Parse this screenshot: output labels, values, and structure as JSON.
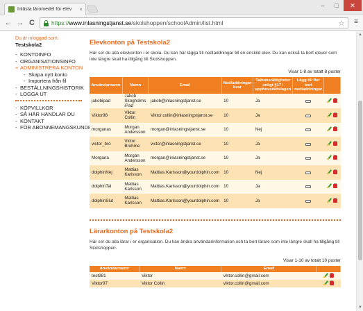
{
  "browser": {
    "tab_title": "Inlästa läromedel för elev",
    "tab_close": "×",
    "url_scheme": "https://",
    "url_host": "www.inlasningstjanst.se",
    "url_path": "/skolshoppen/schoolAdmin/list.html",
    "back_icon": "←",
    "forward_icon": "→",
    "reload_icon": "C",
    "star_icon": "☆",
    "menu_icon": "≡",
    "minimize": "–",
    "maximize": "□",
    "close": "✕"
  },
  "sidebar": {
    "logged_in_label": "Du är inloggad som:",
    "school": "Testskola2",
    "menu1": [
      {
        "bullet": "-",
        "label": "KONTOINFO",
        "active": false
      },
      {
        "bullet": "-",
        "label": "ORGANISATIONSINFO",
        "active": false
      },
      {
        "bullet": "+",
        "label": "ADMINISTRERA KONTON",
        "active": true
      }
    ],
    "submenu": [
      {
        "bullet": "-",
        "label": "Skapa nytt konto"
      },
      {
        "bullet": "-",
        "label": "Importera från fil"
      }
    ],
    "menu2": [
      {
        "bullet": "-",
        "label": "BESTÄLLNINGSHISTORIK"
      },
      {
        "bullet": "-",
        "label": "LOGGA UT"
      }
    ],
    "menu3": [
      {
        "bullet": "-",
        "label": "KÖPVILLKOR"
      },
      {
        "bullet": "-",
        "label": "SÅ HÄR HANDLAR DU"
      },
      {
        "bullet": "-",
        "label": "KONTAKT"
      },
      {
        "bullet": "-",
        "label": "FÖR ABONNEMANGSKUNDER"
      }
    ]
  },
  "students": {
    "title": "Elevkonton på Testskola2",
    "description": "Här ser du alla elevkonton i er skola. Du kan här lägga till nedladdningar till en enskild elev. Du kan också ta bort elever som inte längre skall ha tillgång till Skolshoppen.",
    "showing": "Visar 1-8 av totalt 8 poster",
    "columns": [
      "Användarnamn",
      "Namn",
      "Email",
      "Nedladdningar kvar",
      "Talboksrättigheter enligt §17 i upphovsrättslagen",
      "Lägg till fler bort nedladdningar",
      ""
    ],
    "rows": [
      {
        "username": "jakobipad",
        "name": "Jakob Skogholms iPad",
        "email": "jakob@inlasningstjanst.se",
        "downloads": "10",
        "rights": "Ja"
      },
      {
        "username": "Viktor98",
        "name": "Viktor Collin",
        "email": "Viktor.collin@inlasningstjanst.se",
        "downloads": "10",
        "rights": "Ja"
      },
      {
        "username": "morganas",
        "name": "Morgan Andersson",
        "email": "morgan@inlasningstjanst.se",
        "downloads": "10",
        "rights": "Nej"
      },
      {
        "username": "victor_bro",
        "name": "Victor Brohme",
        "email": "victor@inlasningstjanst.se",
        "downloads": "10",
        "rights": "Ja"
      },
      {
        "username": "Morgana",
        "name": "Morgan Andersson",
        "email": "morgan@inlasningstjanst.se",
        "downloads": "10",
        "rights": "Ja"
      },
      {
        "username": "dolphinNej",
        "name": "Mattias Karlsson",
        "email": "Mattias.Karlsson@yourdolphin.com",
        "downloads": "10",
        "rights": "Nej"
      },
      {
        "username": "dolphinTal",
        "name": "Mattias Karlsson",
        "email": "Mattias.Karlsson@yourdolphin.com",
        "downloads": "10",
        "rights": "Ja"
      },
      {
        "username": "dolphinSlut",
        "name": "Mattias Karlsson",
        "email": "Mattias.Karlsson@yourdolphin.com",
        "downloads": "10",
        "rights": "Ja"
      }
    ]
  },
  "teachers": {
    "title": "Lärarkonton på Testskola2",
    "description": "Här ser du alla lärar i er organisation. Du kan ändra användarinformation och ta bort lärare som inte längre skall ha tillgång till Skolshoppen.",
    "showing": "Visar 1-10 av totalt 10 poster",
    "columns": [
      "Användarnamn",
      "Namn",
      "Email",
      ""
    ],
    "rows": [
      {
        "username": "test981",
        "name": "Viktor",
        "email": "viktor.collin@gmail.com"
      },
      {
        "username": "Viktor97",
        "name": "Viktor Collin",
        "email": "viktor.collin@gmail.com"
      }
    ]
  },
  "colors": {
    "accent": "#e8691d",
    "header": "#f07f21",
    "row_odd": "#fff8e6",
    "row_even": "#fde2b4"
  },
  "icons": {
    "download_card": "card-icon",
    "edit": "edit-icon",
    "delete": "delete-icon"
  }
}
